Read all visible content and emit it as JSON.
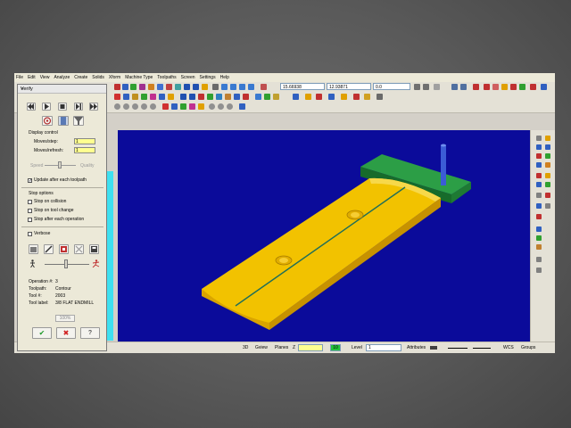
{
  "menu": [
    "File",
    "Edit",
    "View",
    "Analyze",
    "Create",
    "Solids",
    "Xform",
    "Machine Type",
    "Toolpaths",
    "Screen",
    "Settings",
    "Help"
  ],
  "toolbar": {
    "coord_x": "15.66938",
    "coord_y": "12.93871",
    "coord_z": "0.0"
  },
  "verify": {
    "title": "Verify",
    "close": "×",
    "display_control_header": "Display control",
    "moves_step_label": "Moves/step:",
    "moves_step_value": "1",
    "moves_refresh_label": "Moves/refresh:",
    "moves_refresh_value": "1",
    "speed_label": "Speed",
    "quality_label": "Quality",
    "update_after_each": "Update after each toolpath",
    "stop_options_header": "Stop options",
    "stop_on_collision": "Stop on collision",
    "stop_on_tool_change": "Stop on tool change",
    "stop_after_each_operation": "Stop after each operation",
    "verbose_label": "Verbose",
    "operation_label": "Operation #:",
    "operation_value": "3",
    "toolpath_label": "Toolpath:",
    "toolpath_value": "Contour",
    "tool_number_label": "Tool #:",
    "tool_number_value": "2003",
    "tool_label_label": "Tool label:",
    "tool_label_value": "3/8 FLAT ENDMILL",
    "progress_text": "100%",
    "ok_symbol": "✔",
    "cancel_symbol": "✖",
    "help_symbol": "?"
  },
  "status": {
    "view_3d": "3D",
    "gview": "Gview",
    "planes": "Planes",
    "z_label": "Z",
    "level_label": "Level",
    "level_value": "1",
    "color_value": "10",
    "attributes": "Attributes",
    "wcs": "WCS",
    "groups": "Groups"
  },
  "colors": {
    "viewport_bg": "#0b0b9a",
    "part": "#f2c200",
    "stock": "#1f8a3a",
    "tool": "#3b5cd6",
    "field_yellow": "#ffff90"
  }
}
